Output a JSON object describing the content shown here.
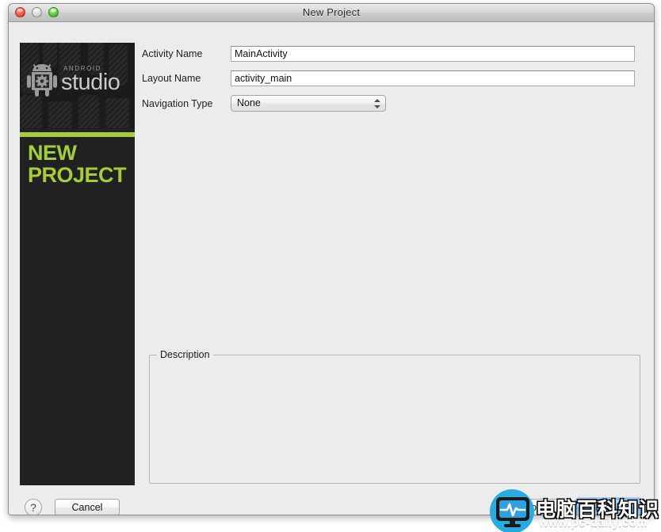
{
  "window": {
    "title": "New Project",
    "traffic_lights": [
      {
        "name": "close",
        "color": "#f24b3f"
      },
      {
        "name": "minimize",
        "color": "#d5d5d5"
      },
      {
        "name": "zoom",
        "color": "#53c32f"
      }
    ]
  },
  "banner": {
    "logo_android": "ANDROID",
    "logo_studio": "studio",
    "heading_line1": "NEW",
    "heading_line2": "PROJECT",
    "accent_color": "#a4cd39",
    "background_color": "#212121"
  },
  "form": {
    "fields": [
      {
        "label": "Activity Name",
        "value": "MainActivity",
        "type": "text"
      },
      {
        "label": "Layout Name",
        "value": "activity_main",
        "type": "text"
      },
      {
        "label": "Navigation Type",
        "value": "None",
        "type": "popup"
      }
    ]
  },
  "description": {
    "group_title": "Description",
    "body_text": ""
  },
  "footer": {
    "help_label": "?",
    "cancel_label": "Cancel",
    "previous_label": "Previous",
    "finish_label": "Finish",
    "finish_accent": "#6fb2f1"
  },
  "watermark": {
    "site_name": "电脑百科知识",
    "url": "www.pc-daily.com",
    "brand_color": "#29abe2"
  }
}
